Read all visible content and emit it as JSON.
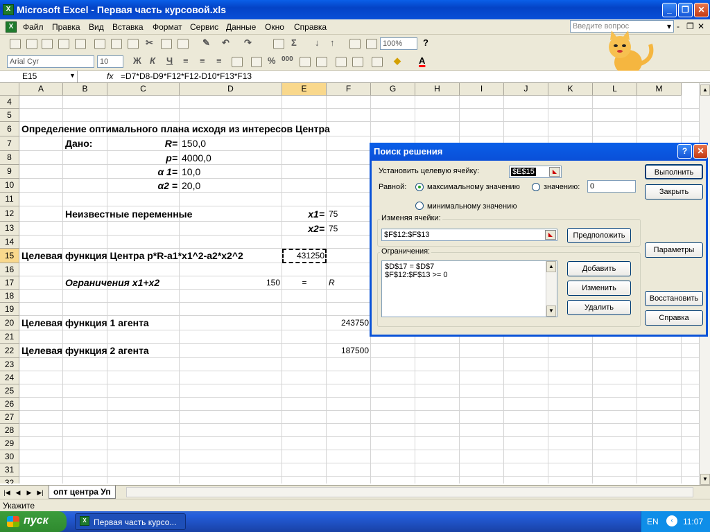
{
  "window": {
    "title": "Microsoft Excel - Первая часть курсовой.xls"
  },
  "menu": [
    "Файл",
    "Правка",
    "Вид",
    "Вставка",
    "Формат",
    "Сервис",
    "Данные",
    "Окно",
    "Справка"
  ],
  "help_placeholder": "Введите вопрос",
  "toolbar": {
    "zoom": "100%",
    "font": "Arial Cyr",
    "size": "10"
  },
  "formula_bar": {
    "name_box": "E15",
    "fx": "fx",
    "formula": "=D7*D8-D9*F12*F12-D10*F13*F13"
  },
  "columns": [
    "A",
    "B",
    "C",
    "D",
    "E",
    "F",
    "G",
    "H",
    "I",
    "J",
    "K",
    "L",
    "M"
  ],
  "rows": [
    "4",
    "5",
    "6",
    "7",
    "8",
    "9",
    "10",
    "11",
    "12",
    "13",
    "14",
    "15",
    "16",
    "17",
    "18",
    "19",
    "20",
    "21",
    "22",
    "23",
    "24",
    "25",
    "26",
    "27",
    "28",
    "29",
    "30",
    "31",
    "32"
  ],
  "cells": {
    "title": "Определение оптимального плана исходя из интересов Центра",
    "dano": "Дано:",
    "R_label": "R=",
    "R_val": "150,0",
    "p_label": "p=",
    "p_val": "4000,0",
    "a1_label": "α 1=",
    "a1_val": "10,0",
    "a2_label": "α2 =",
    "a2_val": "20,0",
    "unknown": "Неизвестные переменные",
    "x1_label": "x1=",
    "x1_val": "75",
    "x2_label": "x2=",
    "x2_val": "75",
    "goal_center": "Целевая функция Центра p*R-a1*x1^2-a2*x2^2",
    "goal_center_val": "431250",
    "constraint": "Ограничения x1+x2",
    "constraint_val": "150",
    "eq": "=",
    "R_ref": "R",
    "agent1": "Целевая функция 1 агента",
    "agent1_val": "243750",
    "agent2": "Целевая функция 2 агента",
    "agent2_val": "187500"
  },
  "sheet_tab": "опт центра Уп",
  "status": "Укажите",
  "taskbar": {
    "start": "пуск",
    "task": "Первая часть курсо...",
    "lang": "EN",
    "time": "11:07"
  },
  "dialog": {
    "title": "Поиск решения",
    "target_label": "Установить целевую ячейку:",
    "target_value": "$E$15",
    "equal_label": "Равной:",
    "opt_max": "максимальному значению",
    "opt_value": "значению:",
    "value_field": "0",
    "opt_min": "минимальному значению",
    "changing_label": "Изменяя ячейки:",
    "changing_value": "$F$12:$F$13",
    "guess": "Предположить",
    "constraints_label": "Ограничения:",
    "constraints": [
      "$D$17 = $D$7",
      "$F$12:$F$13 >= 0"
    ],
    "add": "Добавить",
    "change": "Изменить",
    "delete": "Удалить",
    "solve": "Выполнить",
    "close": "Закрыть",
    "options": "Параметры",
    "reset": "Восстановить",
    "help": "Справка"
  }
}
